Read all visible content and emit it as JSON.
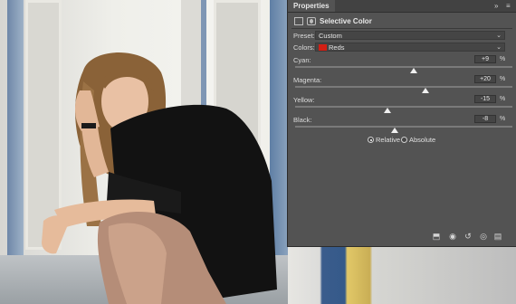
{
  "panel": {
    "tab_label": "Properties",
    "tab_controls": {
      "collapse_glyph": "»",
      "menu_glyph": "≡"
    },
    "title": "Selective Color",
    "header_icons": [
      "adjustment-layer-icon",
      "mask-icon"
    ],
    "preset": {
      "label": "Preset:",
      "value": "Custom"
    },
    "colors": {
      "label": "Colors:",
      "value": "Reds",
      "swatch_color": "#d21f14"
    },
    "sliders": [
      {
        "label": "Cyan:",
        "value": "+9",
        "unit": "%",
        "level": 9
      },
      {
        "label": "Magenta:",
        "value": "+20",
        "unit": "%",
        "level": 20
      },
      {
        "label": "Yellow:",
        "value": "-15",
        "unit": "%",
        "level": -15
      },
      {
        "label": "Black:",
        "value": "-8",
        "unit": "%",
        "level": -8
      }
    ],
    "method": {
      "options": [
        "Relative",
        "Absolute"
      ],
      "selected": "Relative"
    },
    "footer_icons": [
      "clip-to-layer-icon",
      "view-previous-state-icon",
      "reset-icon",
      "visibility-icon",
      "trash-icon"
    ]
  },
  "colors": {
    "panel_bg": "#535353",
    "tab_bar": "#424242",
    "swatch_red": "#d21f14"
  }
}
